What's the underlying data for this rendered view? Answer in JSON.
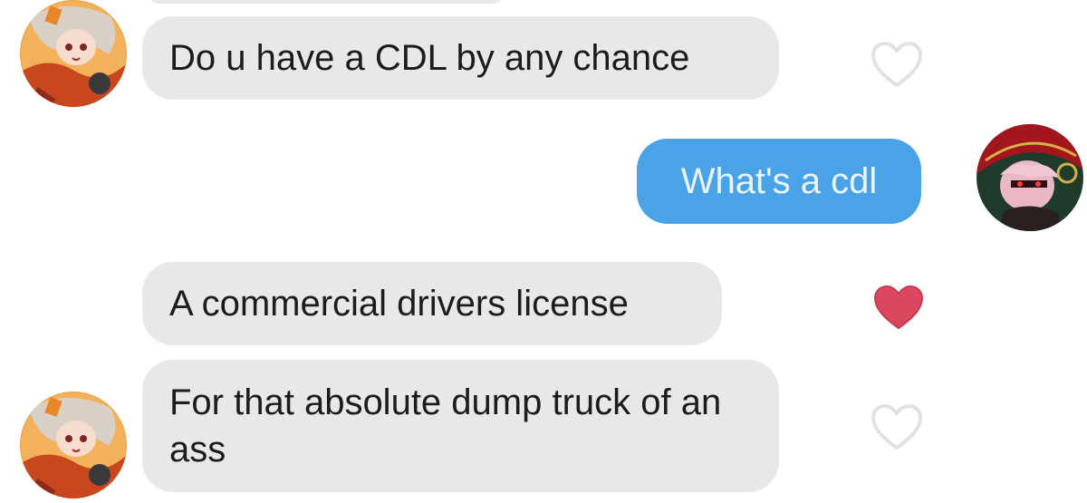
{
  "messages": [
    {
      "text": "Do u have a CDL by any chance",
      "direction": "incoming"
    },
    {
      "text": "What's a cdl",
      "direction": "outgoing"
    },
    {
      "text": "A commercial drivers license",
      "direction": "incoming"
    },
    {
      "text": "For that absolute dump truck of an ass",
      "direction": "incoming"
    }
  ],
  "likes": {
    "msg1": "unliked",
    "msg3": "liked",
    "msg4": "unliked"
  },
  "colors": {
    "incoming_bubble": "#e8e8ea",
    "outgoing_bubble": "#4aa3e6",
    "heart_liked": "#d9485f",
    "heart_outline": "#e3e3e3"
  }
}
